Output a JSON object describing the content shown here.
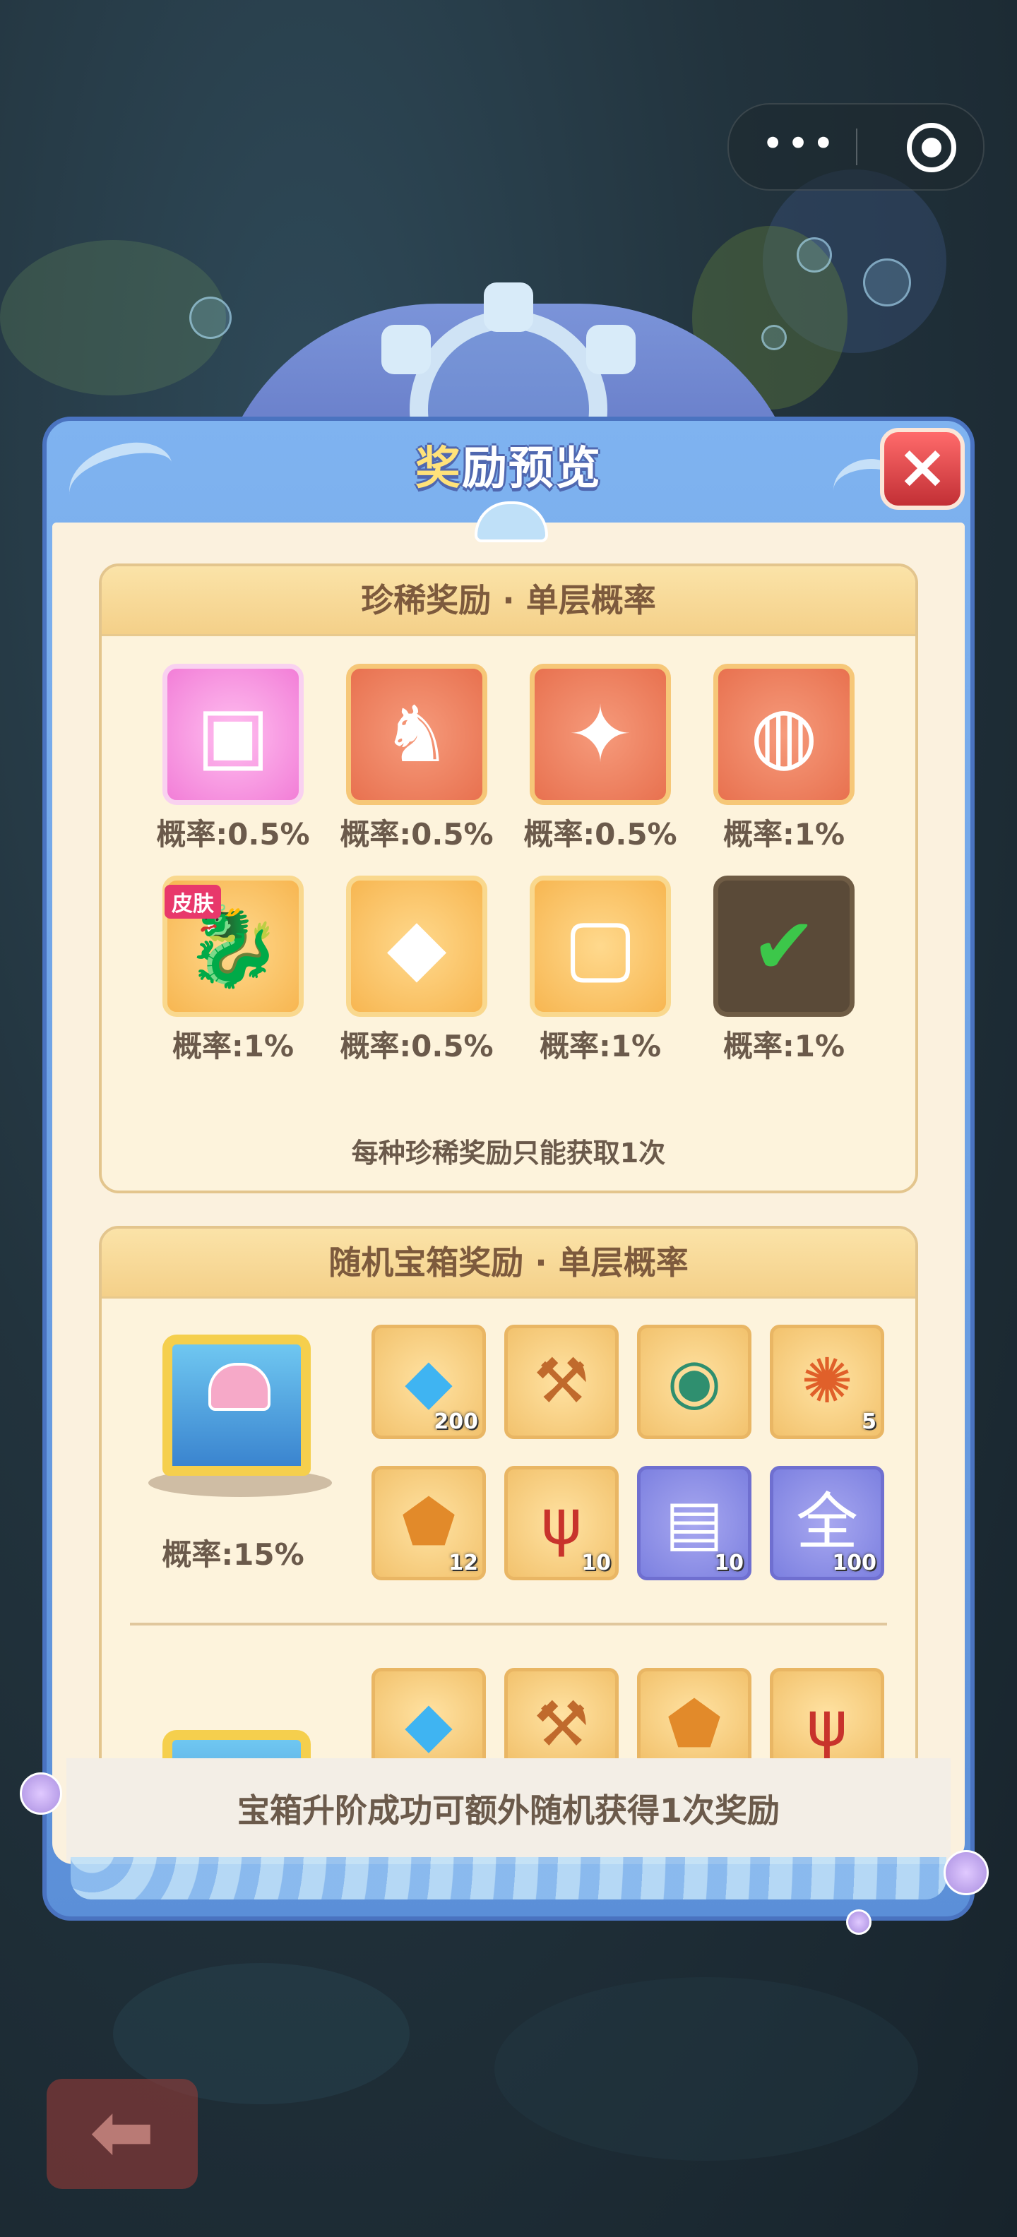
{
  "dialog": {
    "title_part1": "奖",
    "title_part2": "励预览",
    "close_label": "×"
  },
  "top_bar": {
    "menu_icon": "more-dots-icon",
    "menu_glyph": "•••",
    "target_icon": "record-target-icon"
  },
  "rare_section": {
    "title": "珍稀奖励 · 单层概率",
    "items": [
      {
        "icon": "pink-cube-icon",
        "glyph": "▣",
        "style": "pink",
        "prob": "概率:0.5%"
      },
      {
        "icon": "dragon-trophy-icon",
        "glyph": "♞",
        "style": "orange",
        "prob": "概率:0.5%"
      },
      {
        "icon": "winged-crystal-icon",
        "glyph": "✦",
        "style": "orange",
        "prob": "概率:0.5%"
      },
      {
        "icon": "pearl-shell-icon",
        "glyph": "◍",
        "style": "orange",
        "prob": "概率:1%"
      },
      {
        "icon": "dragon-skin-icon",
        "glyph": "🐉",
        "style": "gold",
        "prob": "概率:1%",
        "tag": "皮肤"
      },
      {
        "icon": "gold-ore-icon",
        "glyph": "◆",
        "style": "gold",
        "prob": "概率:0.5%"
      },
      {
        "icon": "avatar-frame-icon",
        "glyph": "▢",
        "style": "gold",
        "prob": "概率:1%"
      },
      {
        "icon": "owned-check-icon",
        "glyph": "✔",
        "style": "dark",
        "prob": "概率:1%"
      }
    ],
    "note": "每种珍稀奖励只能获取1次"
  },
  "chest_section": {
    "title": "随机宝箱奖励 · 单层概率",
    "chest_prob": "概率:15%",
    "row1": [
      {
        "icon": "diamond-icon",
        "glyph": "◆",
        "qty": "200",
        "style": "gold",
        "color": "#3fb4f2"
      },
      {
        "icon": "hammer-icon",
        "glyph": "⚒",
        "qty": "",
        "style": "gold",
        "color": "#c06a2c"
      },
      {
        "icon": "compass-icon",
        "glyph": "◉",
        "qty": "",
        "style": "gold",
        "color": "#2f8f6f"
      },
      {
        "icon": "gear-orb-icon",
        "glyph": "✺",
        "qty": "5",
        "style": "gold",
        "color": "#e0602a"
      }
    ],
    "row2": [
      {
        "icon": "amber-stone-icon",
        "glyph": "⬟",
        "qty": "12",
        "style": "gold",
        "color": "#e28a2a"
      },
      {
        "icon": "coral-icon",
        "glyph": "ψ",
        "qty": "10",
        "style": "gold",
        "color": "#c8332c"
      },
      {
        "icon": "scroll-icon",
        "glyph": "▤",
        "qty": "10",
        "style": "purple",
        "color": "#ffffff"
      },
      {
        "icon": "all-badge-icon",
        "glyph": "全",
        "qty": "100",
        "style": "purple",
        "color": "#ffffff"
      }
    ],
    "row3": [
      {
        "icon": "diamond-icon",
        "glyph": "◆",
        "style": "gold",
        "color": "#3fb4f2"
      },
      {
        "icon": "hammer-icon",
        "glyph": "⚒",
        "style": "gold",
        "color": "#c06a2c"
      },
      {
        "icon": "amber-stone-icon",
        "glyph": "⬟",
        "style": "gold",
        "color": "#e28a2a"
      },
      {
        "icon": "coral-icon",
        "glyph": "ψ",
        "style": "gold",
        "color": "#c8332c"
      }
    ]
  },
  "footer": {
    "text": "宝箱升阶成功可额外随机获得1次奖励"
  },
  "back": {
    "icon": "back-arrow-icon",
    "glyph": "⬅"
  }
}
